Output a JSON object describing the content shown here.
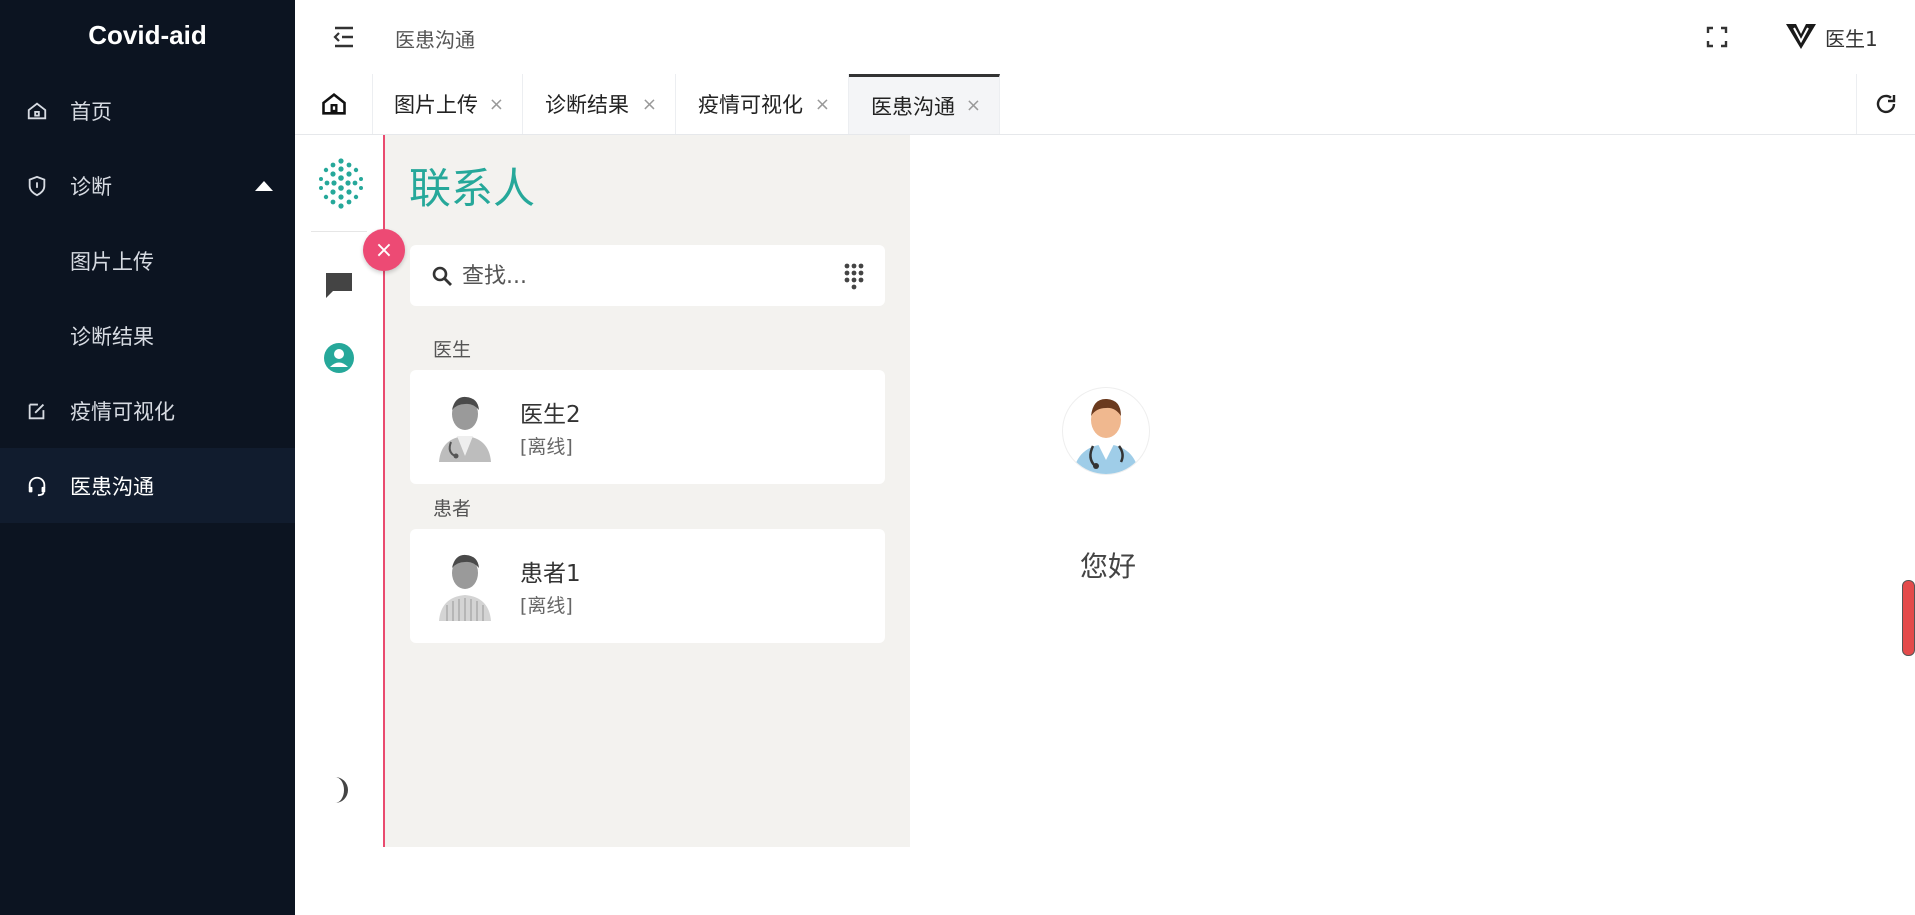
{
  "app": {
    "brand": "Covid-aid"
  },
  "sidebar": {
    "items": [
      {
        "label": "首页",
        "icon": "home-icon"
      },
      {
        "label": "诊断",
        "icon": "shield-icon"
      },
      {
        "label": "图片上传"
      },
      {
        "label": "诊断结果"
      },
      {
        "label": "疫情可视化",
        "icon": "edit-icon"
      },
      {
        "label": "医患沟通",
        "icon": "headset-icon"
      }
    ]
  },
  "header": {
    "breadcrumb": "医患沟通",
    "user": "医生1"
  },
  "tabs": [
    {
      "label": "图片上传",
      "close": "×"
    },
    {
      "label": "诊断结果",
      "close": "×"
    },
    {
      "label": "疫情可视化",
      "close": "×"
    },
    {
      "label": "医患沟通",
      "close": "×"
    }
  ],
  "contacts": {
    "title": "联系人",
    "search_placeholder": "查找...",
    "close": "×",
    "groups": [
      {
        "title": "医生",
        "items": [
          {
            "name": "医生2",
            "status": "[离线]"
          }
        ]
      },
      {
        "title": "患者",
        "items": [
          {
            "name": "患者1",
            "status": "[离线]"
          }
        ]
      }
    ]
  },
  "chat": {
    "greeting": "您好"
  },
  "colors": {
    "accent": "#26a89a",
    "danger": "#ed4a74",
    "sidebar_bg": "#0c1421"
  }
}
